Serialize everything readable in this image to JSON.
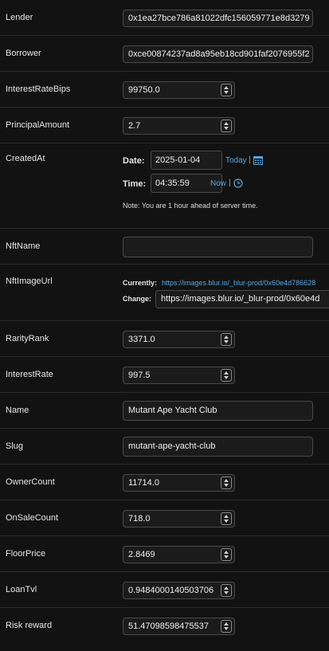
{
  "fields": {
    "lender": {
      "label": "Lender",
      "value": "0x1ea27bce786a81022dfc156059771e8d3279"
    },
    "borrower": {
      "label": "Borrower",
      "value": "0xce00874237ad8a95eb18cd901faf2076955f2"
    },
    "interest_rate_bips": {
      "label": "InterestRateBips",
      "value": "99750.0"
    },
    "principal_amount": {
      "label": "PrincipalAmount",
      "value": "2.7"
    },
    "created_at": {
      "label": "CreatedAt",
      "date_label": "Date:",
      "date_value": "2025-01-04",
      "today_link": "Today",
      "sep1": "|",
      "time_label": "Time:",
      "time_value": "04:35:59",
      "now_link": "Now",
      "sep2": "|",
      "note": "Note: You are 1 hour ahead of server time.",
      "calendar_icon": "calendar-icon",
      "clock_icon": "clock-icon"
    },
    "nft_name": {
      "label": "NftName",
      "value": ""
    },
    "nft_image_url": {
      "label": "NftImageUrl",
      "currently_label": "Currently:",
      "currently_link": "https://images.blur.io/_blur-prod/0x60e4d786628",
      "change_label": "Change:",
      "change_value": "https://images.blur.io/_blur-prod/0x60e4d"
    },
    "rarity_rank": {
      "label": "RarityRank",
      "value": "3371.0"
    },
    "interest_rate": {
      "label": "InterestRate",
      "value": "997.5"
    },
    "name": {
      "label": "Name",
      "value": "Mutant Ape Yacht Club"
    },
    "slug": {
      "label": "Slug",
      "value": "mutant-ape-yacht-club"
    },
    "owner_count": {
      "label": "OwnerCount",
      "value": "11714.0"
    },
    "on_sale_count": {
      "label": "OnSaleCount",
      "value": "718.0"
    },
    "floor_price": {
      "label": "FloorPrice",
      "value": "2.8469"
    },
    "loan_tvl": {
      "label": "LoanTvl",
      "value": "0.9484000140503706"
    },
    "risk_reward": {
      "label": "Risk reward",
      "value": "51.47098598475537"
    }
  },
  "colors": {
    "background": "#121212",
    "link": "#5aa5e0",
    "border": "#2b2b2b"
  }
}
